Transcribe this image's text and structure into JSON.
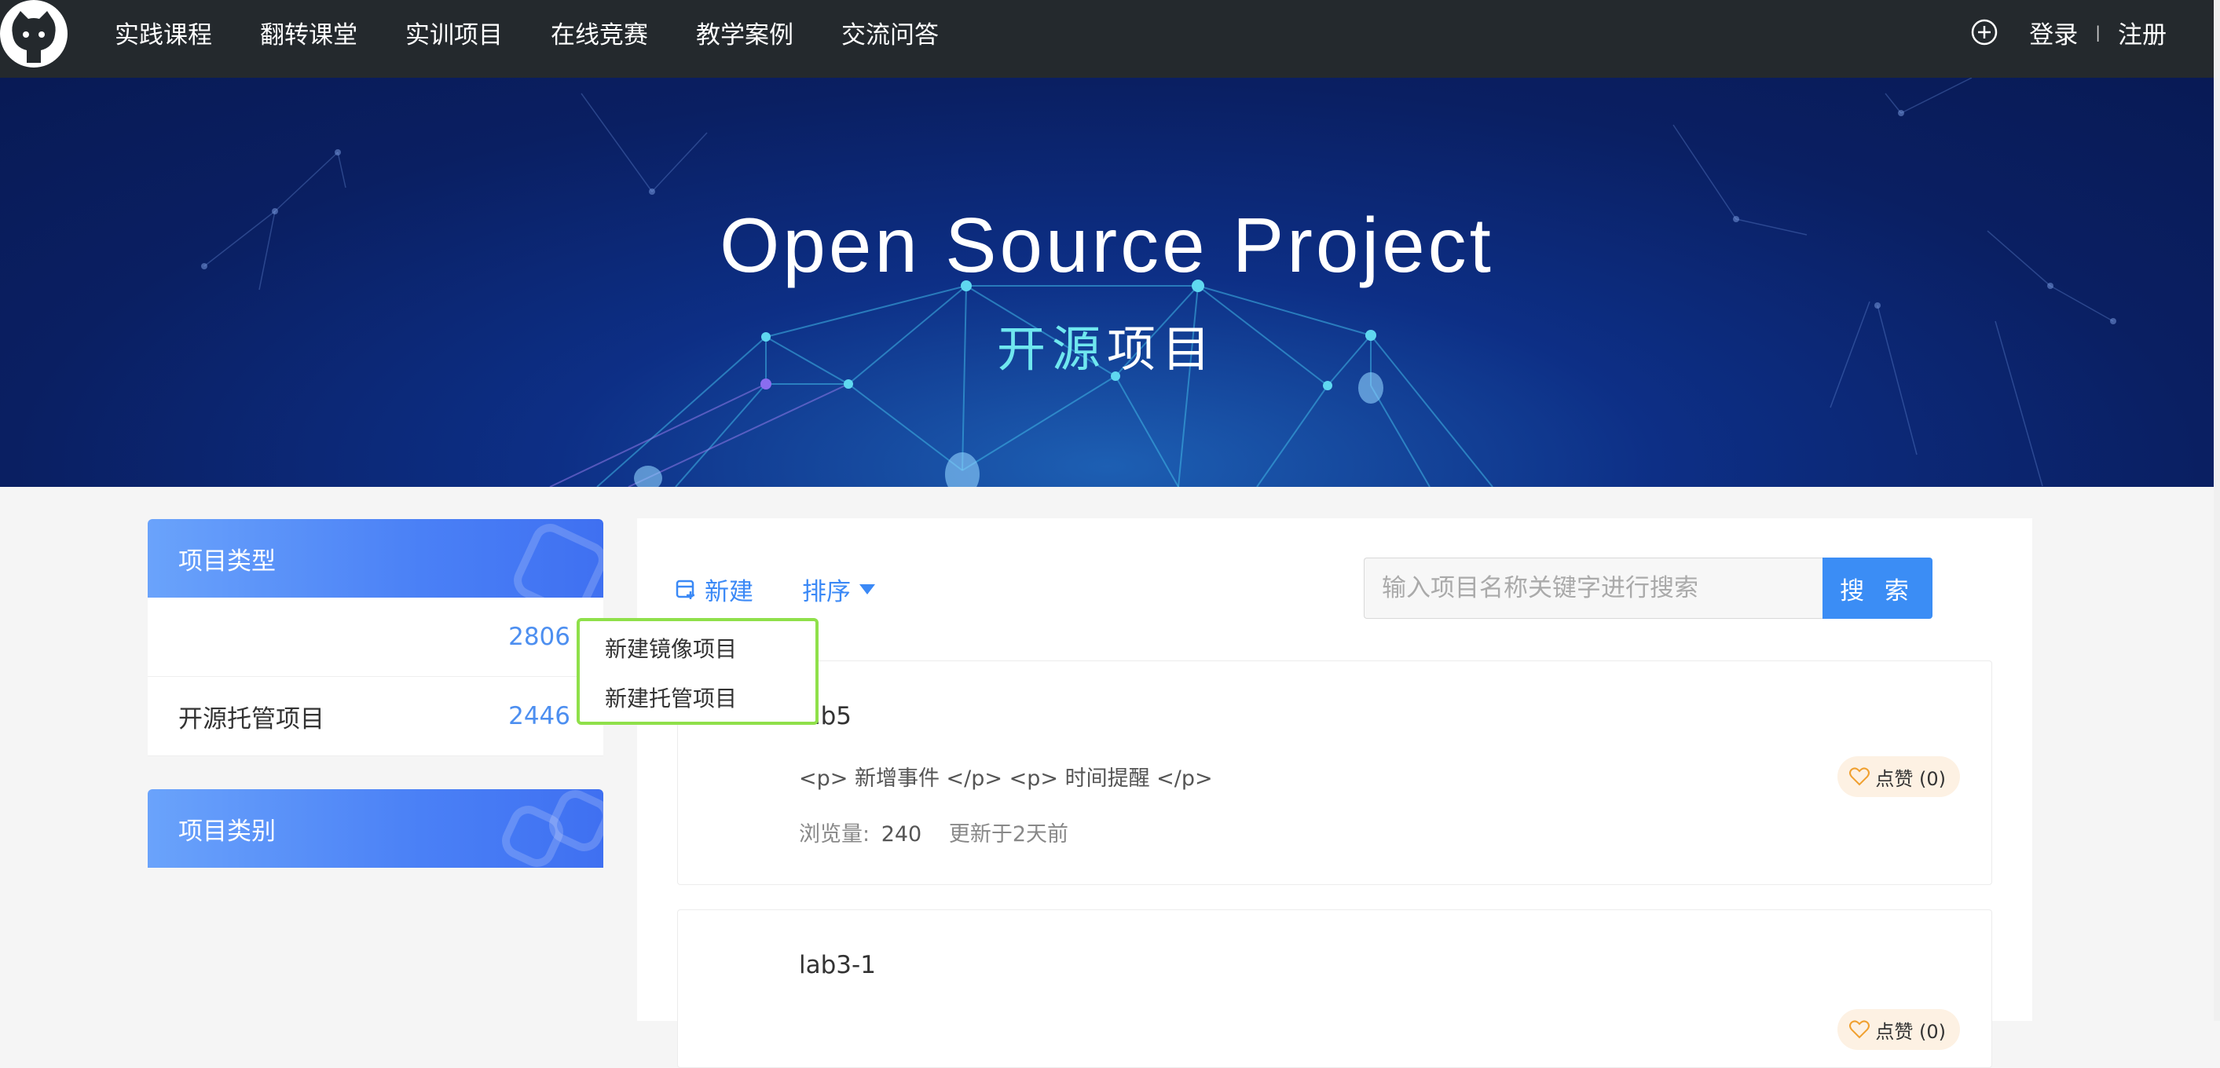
{
  "nav": {
    "items": [
      "实践课程",
      "翻转课堂",
      "实训项目",
      "在线竞赛",
      "教学案例",
      "交流问答"
    ],
    "login": "登录",
    "separator": "|",
    "register": "注册",
    "plus_icon": "plus-circle-icon",
    "logo_icon": "github-octocat-logo"
  },
  "banner": {
    "title": "Open Source Project",
    "subtitle_highlight": "开源",
    "subtitle_rest": "项目",
    "highlight_color": "#6fe7ef"
  },
  "sidebar": {
    "type_card": {
      "title": "项目类型",
      "rows": [
        {
          "label": "",
          "count": "2806"
        },
        {
          "label": "开源托管项目",
          "count": "2446"
        }
      ]
    },
    "category_card": {
      "title": "项目类别"
    }
  },
  "toolbar": {
    "new_label": "新建",
    "sort_label": "排序",
    "accent": "#3b89f6"
  },
  "search": {
    "placeholder": "输入项目名称关键字进行搜索",
    "value": "",
    "button_label": "搜 索"
  },
  "dropdown": {
    "items": [
      "新建镜像项目",
      "新建托管项目"
    ]
  },
  "projects": [
    {
      "title": "lab5",
      "desc": "<p> 新增事件 </p> <p> 时间提醒 </p>",
      "views_label": "浏览量:",
      "views": "240",
      "updated": "更新于2天前",
      "like_label": "点赞 (0)"
    },
    {
      "title": "lab3-1",
      "like_label": "点赞 (0)"
    }
  ]
}
